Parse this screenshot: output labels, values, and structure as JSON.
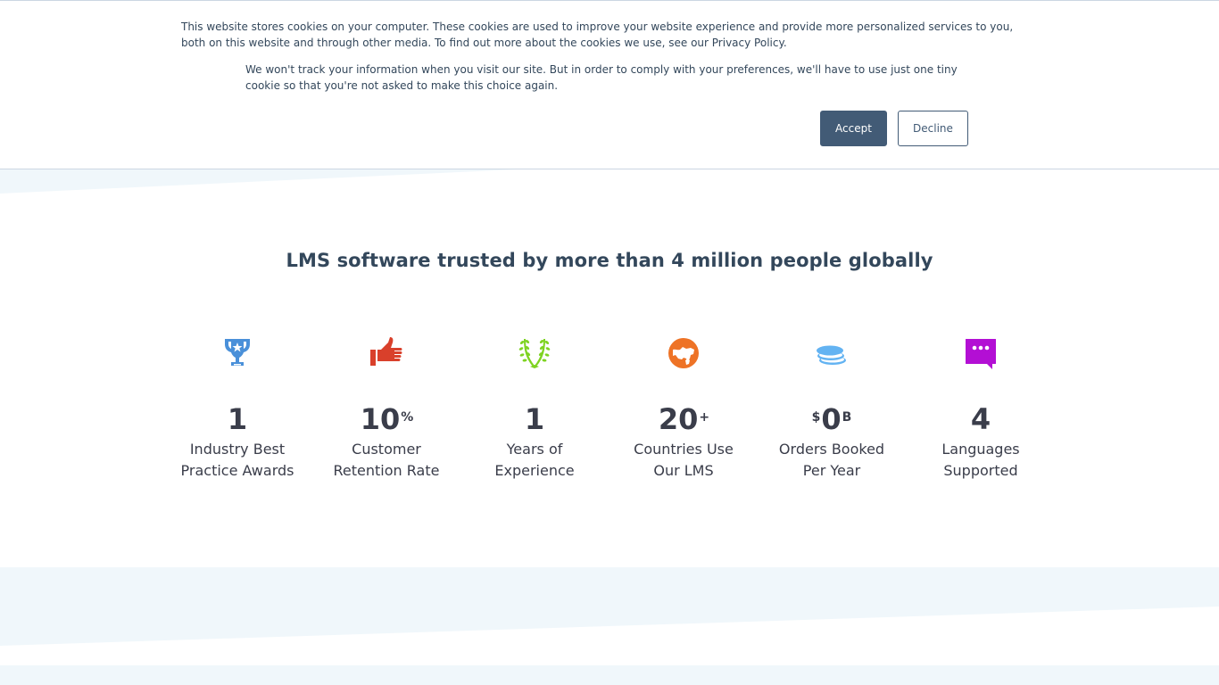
{
  "cookie_banner": {
    "message": "This website stores cookies on your computer. These cookies are used to improve your website experience and provide more personalized services to you, both on this website and through other media. To find out more about the cookies we use, see our Privacy Policy.",
    "decline_note": "We won't track your information when you visit our site. But in order to comply with your preferences, we'll have to use just one tiny cookie so that you're not asked to make this choice again.",
    "accept_label": "Accept",
    "decline_label": "Decline"
  },
  "headline": {
    "prefix": "LMS software trusted by ",
    "emphasis": "more than 4 million",
    "suffix": " people globally"
  },
  "stats": [
    {
      "icon": "trophy-icon",
      "color": "#4a90d9",
      "prefix": "",
      "value": "1",
      "suffix": "",
      "label_line1": "Industry Best",
      "label_line2": "Practice Awards"
    },
    {
      "icon": "thumbs-up-icon",
      "color": "#d9402b",
      "prefix": "",
      "value": "10",
      "suffix": "%",
      "label_line1": "Customer",
      "label_line2": "Retention Rate"
    },
    {
      "icon": "laurel-icon",
      "color": "#7ed321",
      "prefix": "",
      "value": "1",
      "suffix": "",
      "label_line1": "Years of",
      "label_line2": "Experience"
    },
    {
      "icon": "globe-icon",
      "color": "#ee7326",
      "prefix": "",
      "value": "20",
      "suffix": "+",
      "label_line1": "Countries Use",
      "label_line2": "Our LMS"
    },
    {
      "icon": "coins-icon",
      "color": "#63b3f2",
      "prefix": "$",
      "value": "0",
      "suffix": "B",
      "label_line1": "Orders Booked",
      "label_line2": "Per Year"
    },
    {
      "icon": "chat-bubble-icon",
      "color": "#b30fd4",
      "prefix": "",
      "value": "4",
      "suffix": "",
      "label_line1": "Languages",
      "label_line2": "Supported"
    }
  ]
}
